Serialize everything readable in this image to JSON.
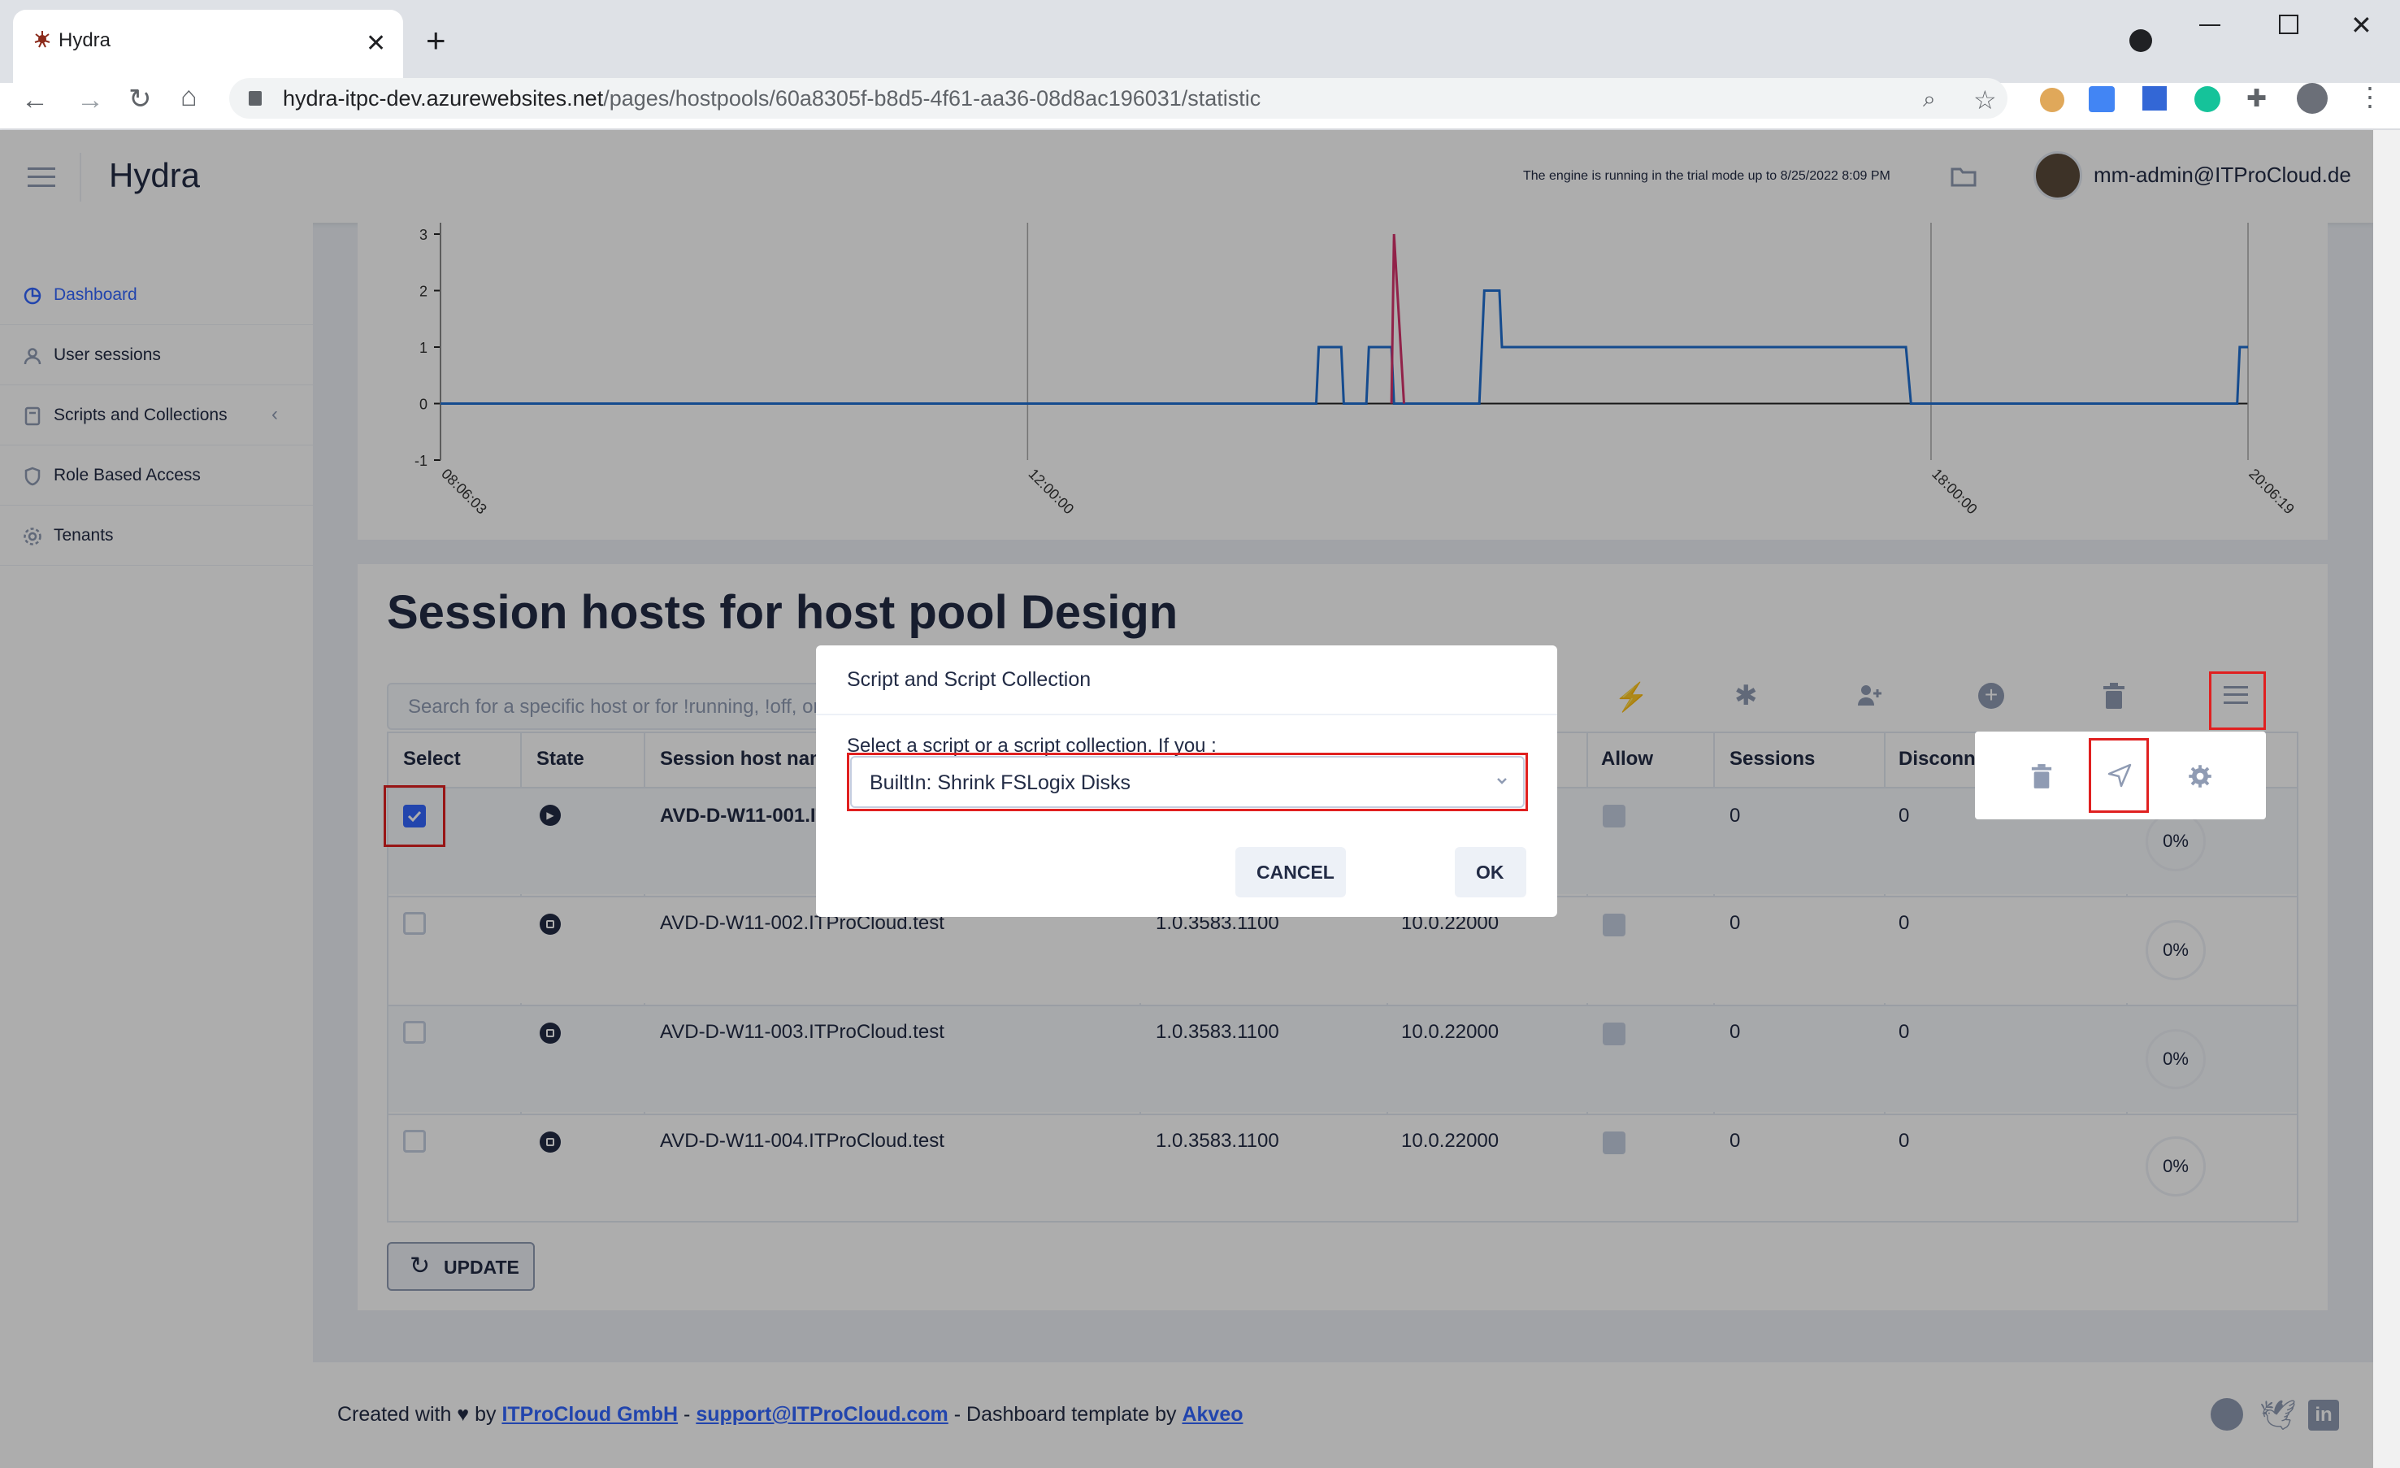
{
  "browser": {
    "tab_title": "Hydra",
    "url_host": "hydra-itpc-dev.azurewebsites.net",
    "url_path": "/pages/hostpools/60a8305f-b8d5-4f61-aa36-08d8ac196031/statistic"
  },
  "header": {
    "app_title": "Hydra",
    "trial_notice": "The engine is running in the trial mode up to 8/25/2022 8:09 PM",
    "user": "mm-admin@ITProCloud.de"
  },
  "sidebar": {
    "items": [
      {
        "label": "Dashboard",
        "active": true
      },
      {
        "label": "User sessions"
      },
      {
        "label": "Scripts and Collections"
      },
      {
        "label": "Role Based Access"
      },
      {
        "label": "Tenants"
      }
    ]
  },
  "chart_data": {
    "type": "line",
    "x_ticks": [
      "08:06:03",
      "12:00:00",
      "18:00:00",
      "20:06:19"
    ],
    "y_ticks": [
      "-1",
      "0",
      "1",
      "2",
      "3"
    ],
    "ylim": [
      -1,
      3
    ],
    "series": [
      {
        "color": "#1f6fd1",
        "points": [
          [
            "08:06:03",
            0
          ],
          [
            "13:55",
            0
          ],
          [
            "13:56",
            1
          ],
          [
            "14:05",
            1
          ],
          [
            "14:06",
            0
          ],
          [
            "14:15",
            0
          ],
          [
            "14:16",
            1
          ],
          [
            "14:25",
            1
          ],
          [
            "14:26",
            0
          ],
          [
            "15:00",
            0
          ],
          [
            "15:02",
            2
          ],
          [
            "15:08",
            2
          ],
          [
            "15:09",
            1
          ],
          [
            "17:50",
            1
          ],
          [
            "17:52",
            0
          ],
          [
            "20:02",
            0
          ],
          [
            "20:03",
            1
          ],
          [
            "20:06:19",
            1
          ]
        ]
      },
      {
        "color": "#d6336c",
        "points": [
          [
            "14:25",
            0
          ],
          [
            "14:26",
            3
          ],
          [
            "14:30",
            0
          ]
        ]
      }
    ]
  },
  "hosts": {
    "title": "Session hosts for host pool Design",
    "search_placeholder": "Search for a specific host or for !running, !off, or",
    "columns": [
      "Select",
      "State",
      "Session host nam",
      "Allow",
      "Sessions",
      "Disconn"
    ],
    "rows": [
      {
        "name": "AVD-D-W11-001.IT",
        "agent": "",
        "os": "",
        "sessions": "0",
        "disconnected": "0",
        "load": "0%",
        "checked": true
      },
      {
        "name": "AVD-D-W11-002.ITProCloud.test",
        "agent": "1.0.3583.1100",
        "os": "10.0.22000",
        "sessions": "0",
        "disconnected": "0",
        "load": "0%",
        "checked": false
      },
      {
        "name": "AVD-D-W11-003.ITProCloud.test",
        "agent": "1.0.3583.1100",
        "os": "10.0.22000",
        "sessions": "0",
        "disconnected": "0",
        "load": "0%",
        "checked": false
      },
      {
        "name": "AVD-D-W11-004.ITProCloud.test",
        "agent": "1.0.3583.1100",
        "os": "10.0.22000",
        "sessions": "0",
        "disconnected": "0",
        "load": "0%",
        "checked": false
      }
    ],
    "update_label": "UPDATE"
  },
  "dialog": {
    "title": "Script and Script Collection",
    "hint": "Select a script or a script collection. If you :",
    "selected": "BuiltIn: Shrink FSLogix Disks",
    "cancel": "CANCEL",
    "ok": "OK"
  },
  "footer": {
    "prefix": "Created with ♥ by ",
    "company": "ITProCloud GmbH",
    "sep": " - ",
    "email": "support@ITProCloud.com",
    "middle": " - Dashboard template by ",
    "akveo": "Akveo"
  }
}
